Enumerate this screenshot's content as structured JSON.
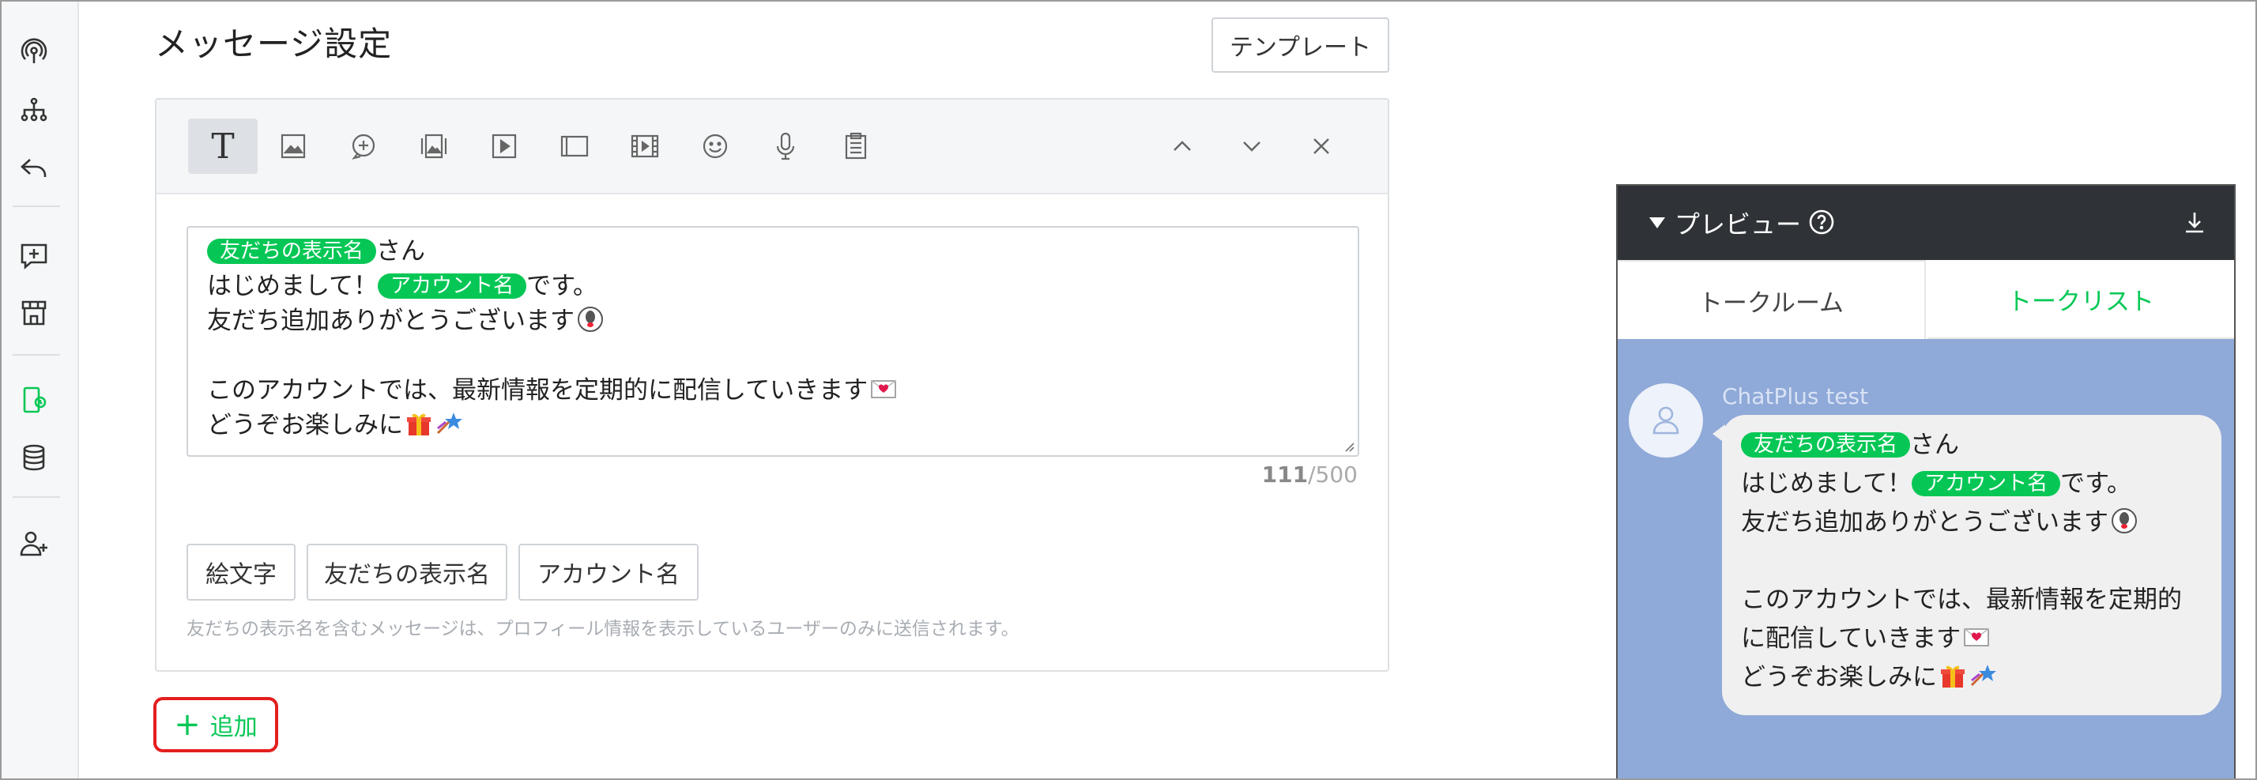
{
  "page": {
    "title": "メッセージ設定",
    "template_label": "テンプレート"
  },
  "sidebar": {
    "items": [
      {
        "icon": "broadcast-icon"
      },
      {
        "icon": "hierarchy-icon"
      },
      {
        "icon": "reply-icon"
      },
      {
        "icon": "add-message-icon"
      },
      {
        "icon": "store-icon"
      },
      {
        "icon": "message-settings-icon",
        "active": true
      },
      {
        "icon": "database-icon"
      },
      {
        "icon": "add-friend-icon"
      }
    ],
    "active_color": "#06c755"
  },
  "editor": {
    "toolbar": [
      "text",
      "image",
      "bubble",
      "image-carousel",
      "video",
      "card",
      "video-carousel",
      "emoji",
      "voice",
      "survey"
    ],
    "toolbar_text_glyph": "T",
    "message": {
      "line1_tag": "友だちの表示名",
      "line1_suffix": "さん",
      "line2_prefix": "はじめまして！",
      "line2_tag": "アカウント名",
      "line2_suffix": "です。",
      "line3": "友だち追加ありがとうございます",
      "line5": "このアカウントでは、最新情報を定期的に配信していきます",
      "line6": "どうぞお楽しみに"
    },
    "counter_current": "111",
    "counter_max": "/500",
    "chips": [
      "絵文字",
      "友だちの表示名",
      "アカウント名"
    ],
    "hint": "友だちの表示名を含むメッセージは、プロフィール情報を表示しているユーザーのみに送信されます。",
    "add_label": "追加",
    "add_plus": "+"
  },
  "preview": {
    "title": "プレビュー",
    "tabs": [
      "トークルーム",
      "トークリスト"
    ],
    "sender": "ChatPlus test",
    "bubble": {
      "line1_tag": "友だちの表示名",
      "line1_suffix": "さん",
      "line2_prefix": "はじめまして！",
      "line2_tag": "アカウント名",
      "line2_suffix": "です。",
      "line3": "友だち追加ありがとうございます",
      "line5a": "このアカウントでは、最新情報を定期的",
      "line5b": "に配信していきます",
      "line6": "どうぞお楽しみに"
    }
  },
  "colors": {
    "tag_green": "#06c755",
    "preview_bg": "#8fa9d8",
    "preview_header": "#2f3337",
    "add_border": "#e41e1e"
  }
}
